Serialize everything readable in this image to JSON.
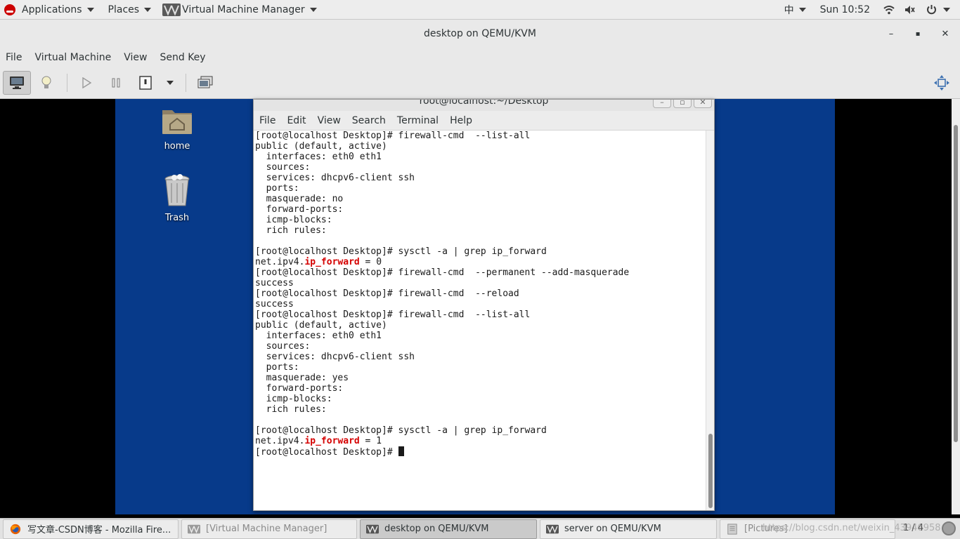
{
  "topbar": {
    "applications": "Applications",
    "places": "Places",
    "app_name": "Virtual Machine Manager",
    "input_method": "中",
    "clock": "Sun 10:52"
  },
  "window": {
    "title": "desktop on QEMU/KVM",
    "minimize": "–",
    "maximize": "▪",
    "close": "✕"
  },
  "menubar": {
    "items": [
      "File",
      "Virtual Machine",
      "View",
      "Send Key"
    ]
  },
  "guest_desktop": {
    "icons": [
      {
        "label": "home"
      },
      {
        "label": "Trash"
      }
    ]
  },
  "terminal": {
    "title": "root@localhost:~/Desktop",
    "menu": [
      "File",
      "Edit",
      "View",
      "Search",
      "Terminal",
      "Help"
    ],
    "lines": [
      "[root@localhost Desktop]# firewall-cmd  --list-all",
      "public (default, active)",
      "  interfaces: eth0 eth1",
      "  sources: ",
      "  services: dhcpv6-client ssh",
      "  ports: ",
      "  masquerade: no",
      "  forward-ports: ",
      "  icmp-blocks: ",
      "  rich rules: ",
      "\t",
      "[root@localhost Desktop]# sysctl -a | grep ip_forward",
      "[root@localhost Desktop]# firewall-cmd  --permanent --add-masquerade",
      "success",
      "[root@localhost Desktop]# firewall-cmd  --reload",
      "success",
      "[root@localhost Desktop]# firewall-cmd  --list-all",
      "public (default, active)",
      "  interfaces: eth0 eth1",
      "  sources: ",
      "  services: dhcpv6-client ssh",
      "  ports: ",
      "  masquerade: yes",
      "  forward-ports: ",
      "  icmp-blocks: ",
      "  rich rules: ",
      "\t",
      "[root@localhost Desktop]# sysctl -a | grep ip_forward",
      "[root@localhost Desktop]# "
    ],
    "forward_lines": [
      {
        "prefix": "net.ipv4.",
        "match": "ip_forward",
        "suffix": " = 0"
      },
      {
        "prefix": "net.ipv4.",
        "match": "ip_forward",
        "suffix": " = 1"
      }
    ]
  },
  "taskbar": {
    "tasks": [
      {
        "label": "写文章-CSDN博客 - Mozilla Fire..."
      },
      {
        "label": "[Virtual Machine Manager]"
      },
      {
        "label": "desktop on QEMU/KVM"
      },
      {
        "label": "server on QEMU/KVM"
      },
      {
        "label": "[Pictures]"
      }
    ],
    "pager": "1 / 4",
    "watermark": "https://blog.csdn.net/weixin_43946958"
  },
  "colors": {
    "guest_desktop_bg": "#073a8a",
    "highlight": "#d50000"
  }
}
